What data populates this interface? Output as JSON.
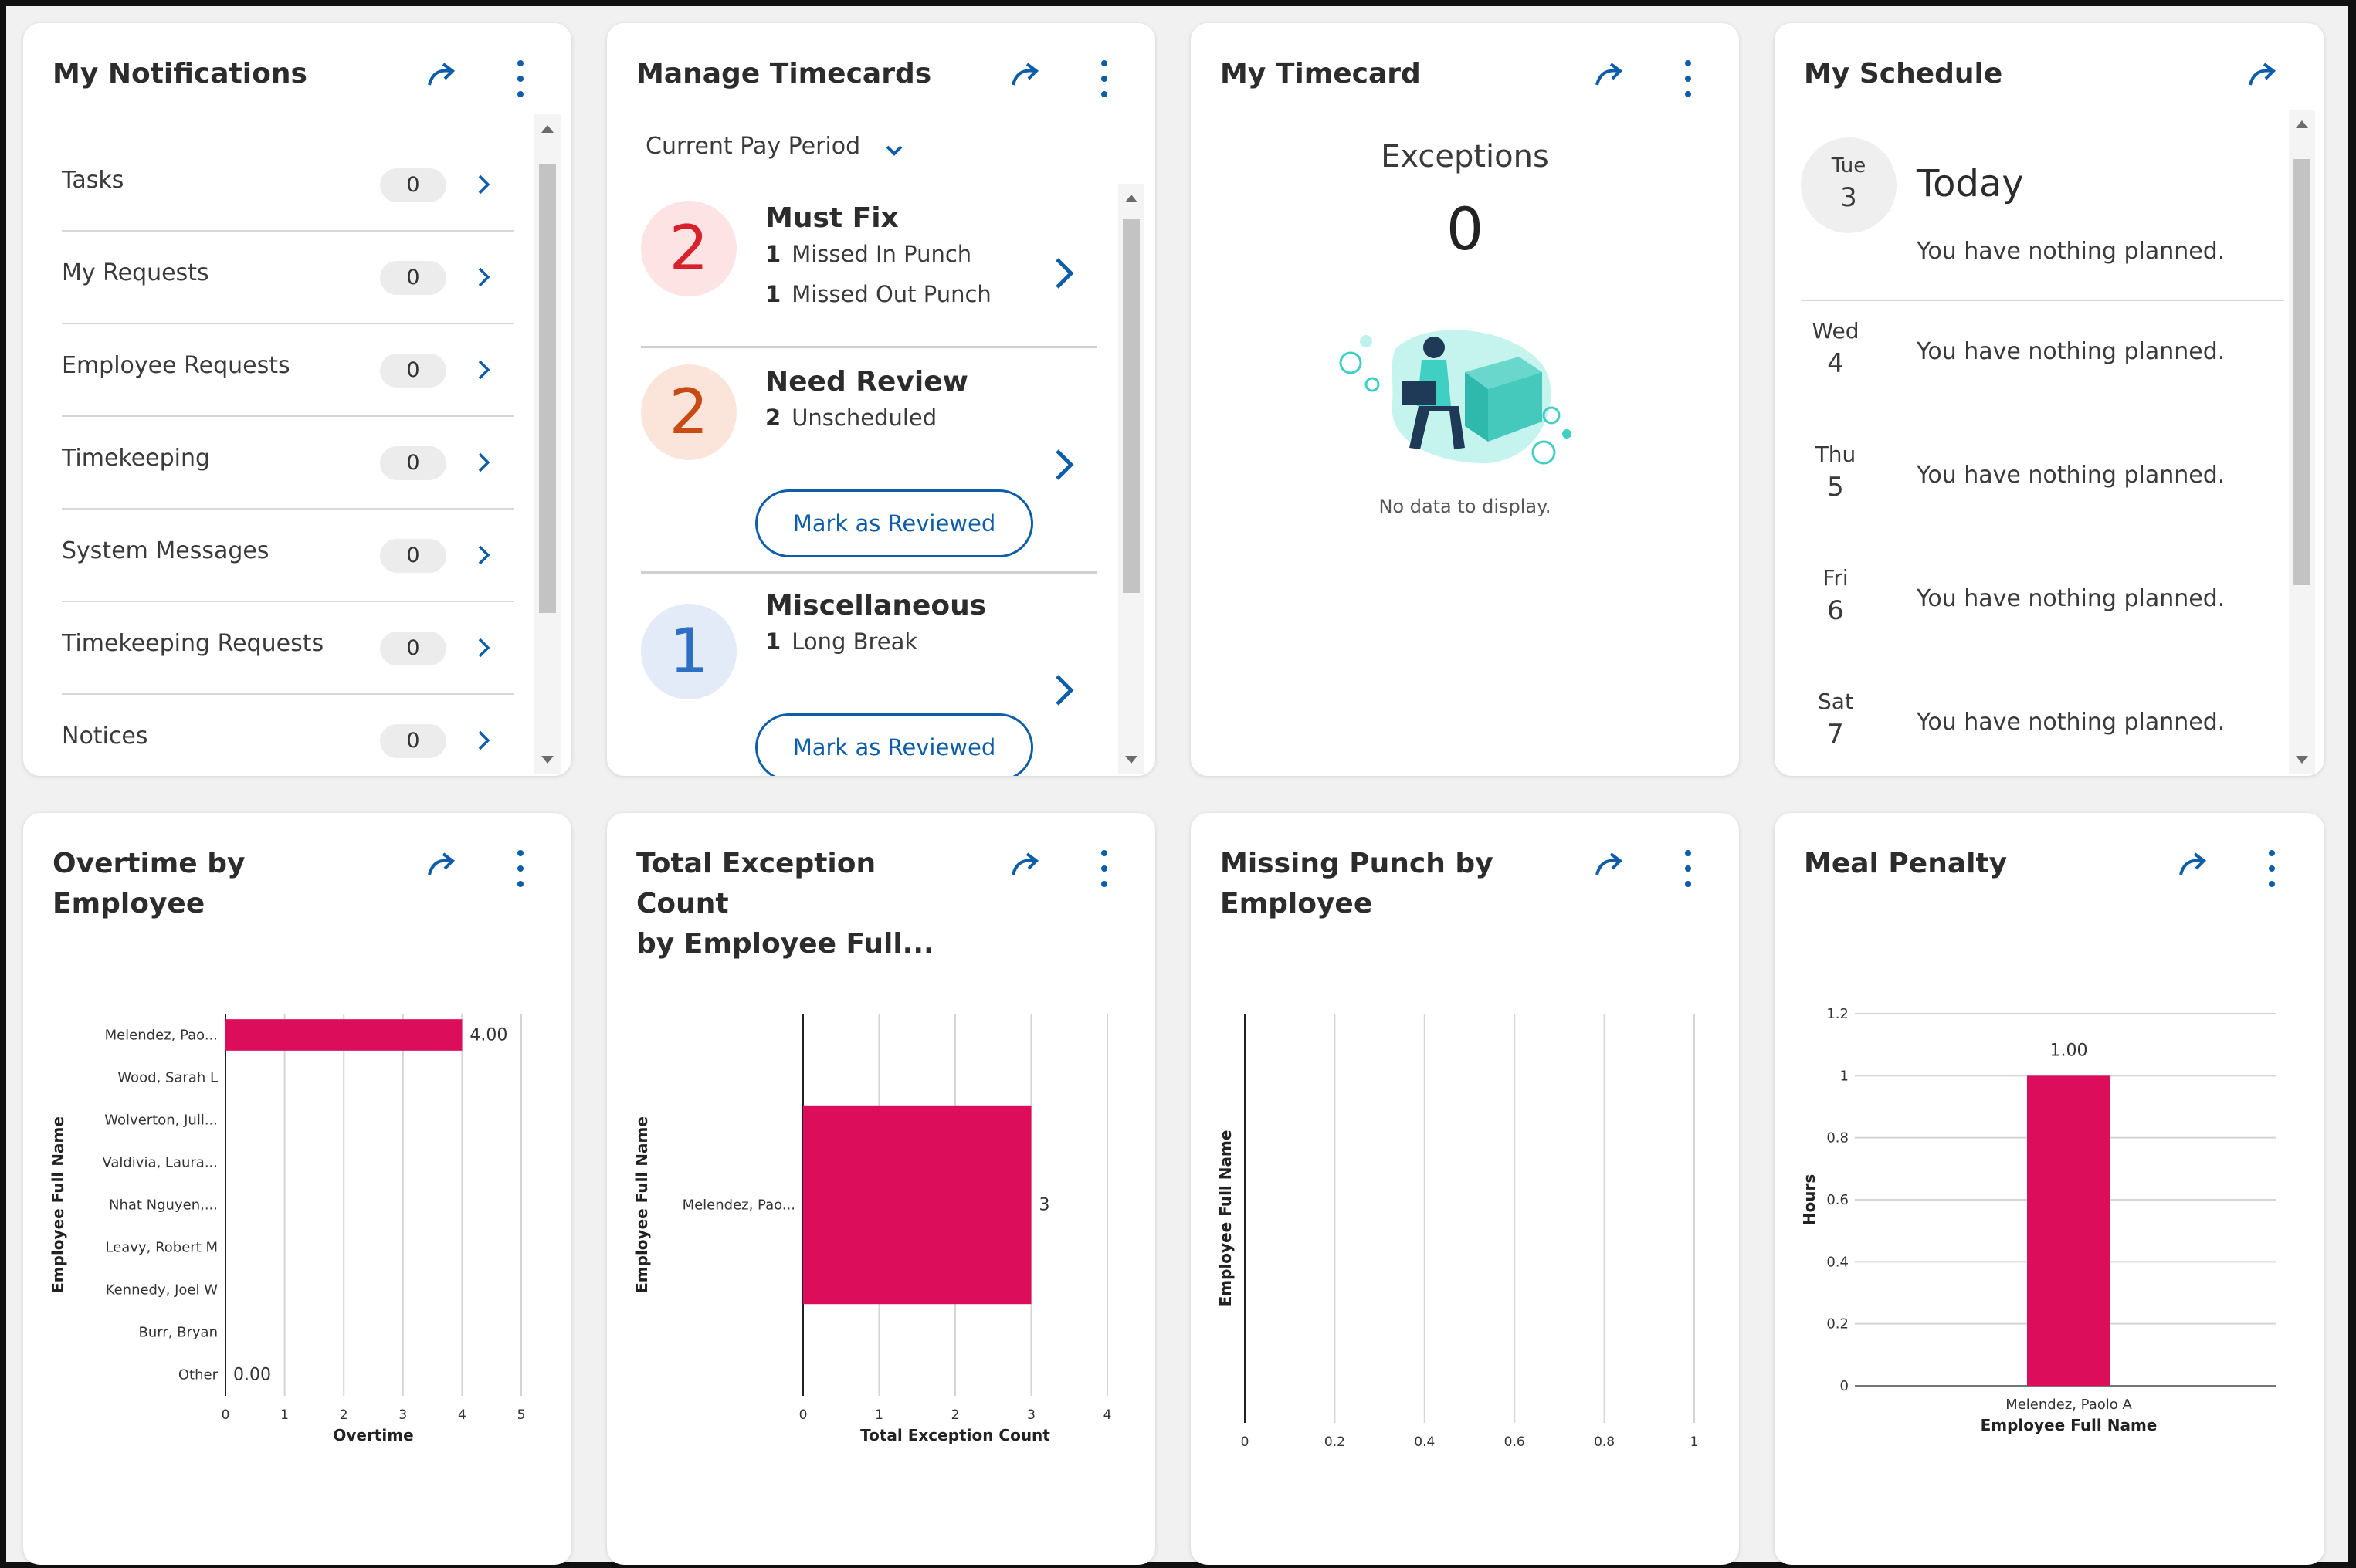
{
  "colors": {
    "accent": "#0e5da8",
    "bar": "#dc0e5c",
    "must_fix": "#d9202d",
    "need_review": "#c84a14",
    "misc": "#2e6fc4"
  },
  "notifications": {
    "title": "My Notifications",
    "items": [
      {
        "label": "Tasks",
        "count": "0"
      },
      {
        "label": "My Requests",
        "count": "0"
      },
      {
        "label": "Employee Requests",
        "count": "0"
      },
      {
        "label": "Timekeeping",
        "count": "0"
      },
      {
        "label": "System Messages",
        "count": "0"
      },
      {
        "label": "Timekeeping Requests",
        "count": "0"
      },
      {
        "label": "Notices",
        "count": "0"
      }
    ]
  },
  "timecards": {
    "title": "Manage Timecards",
    "period": "Current Pay Period",
    "groups": [
      {
        "count": "2",
        "title": "Must Fix",
        "lines": [
          {
            "n": "1",
            "text": "Missed In Punch"
          },
          {
            "n": "1",
            "text": "Missed Out Punch"
          }
        ]
      },
      {
        "count": "2",
        "title": "Need Review",
        "lines": [
          {
            "n": "2",
            "text": "Unscheduled"
          }
        ],
        "button": "Mark as Reviewed"
      },
      {
        "count": "1",
        "title": "Miscellaneous",
        "lines": [
          {
            "n": "1",
            "text": "Long Break"
          }
        ],
        "button": "Mark as Reviewed"
      }
    ]
  },
  "my_timecard": {
    "title": "My Timecard",
    "exceptions_label": "Exceptions",
    "exceptions_value": "0",
    "empty_text": "No data to display."
  },
  "schedule": {
    "title": "My Schedule",
    "today_label": "Today",
    "days": [
      {
        "name": "Tue",
        "date": "3",
        "text": "You have nothing planned."
      },
      {
        "name": "Wed",
        "date": "4",
        "text": "You have nothing planned."
      },
      {
        "name": "Thu",
        "date": "5",
        "text": "You have nothing planned."
      },
      {
        "name": "Fri",
        "date": "6",
        "text": "You have nothing planned."
      },
      {
        "name": "Sat",
        "date": "7",
        "text": "You have nothing planned."
      }
    ]
  },
  "overtime_tile": {
    "title_line1": "Overtime by",
    "title_line2": "Employee"
  },
  "exception_tile": {
    "title_line1": "Total Exception Count",
    "title_line2": "by Employee Full..."
  },
  "missing_tile": {
    "title_line1": "Missing Punch by",
    "title_line2": "Employee"
  },
  "meal_tile": {
    "title": "Meal Penalty"
  },
  "chart_data": [
    {
      "type": "bar",
      "orientation": "horizontal",
      "categories": [
        "Melendez, Pao...",
        "Wood, Sarah L",
        "Wolverton, Jull...",
        "Valdivia, Laura...",
        "Nhat Nguyen,...",
        "Leavy, Robert M",
        "Kennedy, Joel W",
        "Burr, Bryan",
        "Other"
      ],
      "values": [
        4.0,
        null,
        null,
        null,
        null,
        null,
        null,
        null,
        0.0
      ],
      "data_labels": [
        "4.00",
        "",
        "",
        "",
        "",
        "",
        "",
        "",
        "0.00"
      ],
      "xlabel": "Overtime",
      "ylabel": "Employee Full Name",
      "xlim": [
        0,
        5
      ],
      "xticks": [
        "0",
        "1",
        "2",
        "3",
        "4",
        "5"
      ],
      "grid": true
    },
    {
      "type": "bar",
      "orientation": "horizontal",
      "categories": [
        "Melendez, Pao..."
      ],
      "values": [
        3
      ],
      "data_labels": [
        "3"
      ],
      "xlabel": "Total Exception Count",
      "ylabel": "Employee Full Name",
      "xlim": [
        0,
        4
      ],
      "xticks": [
        "0",
        "1",
        "2",
        "3",
        "4"
      ],
      "grid": true
    },
    {
      "type": "bar",
      "orientation": "horizontal",
      "categories": [],
      "values": [],
      "xlabel": "",
      "ylabel": "Employee Full Name",
      "xlim": [
        0,
        1
      ],
      "xticks": [
        "0",
        "0.2",
        "0.4",
        "0.6",
        "0.8",
        "1"
      ],
      "grid": true
    },
    {
      "type": "bar",
      "orientation": "vertical",
      "categories": [
        "Melendez, Paolo A"
      ],
      "values": [
        1.0
      ],
      "data_labels": [
        "1.00"
      ],
      "xlabel": "Employee Full Name",
      "ylabel": "Hours",
      "ylim": [
        0,
        1.2
      ],
      "yticks": [
        "0",
        "0.2",
        "0.4",
        "0.6",
        "0.8",
        "1",
        "1.2"
      ],
      "grid": true
    }
  ]
}
